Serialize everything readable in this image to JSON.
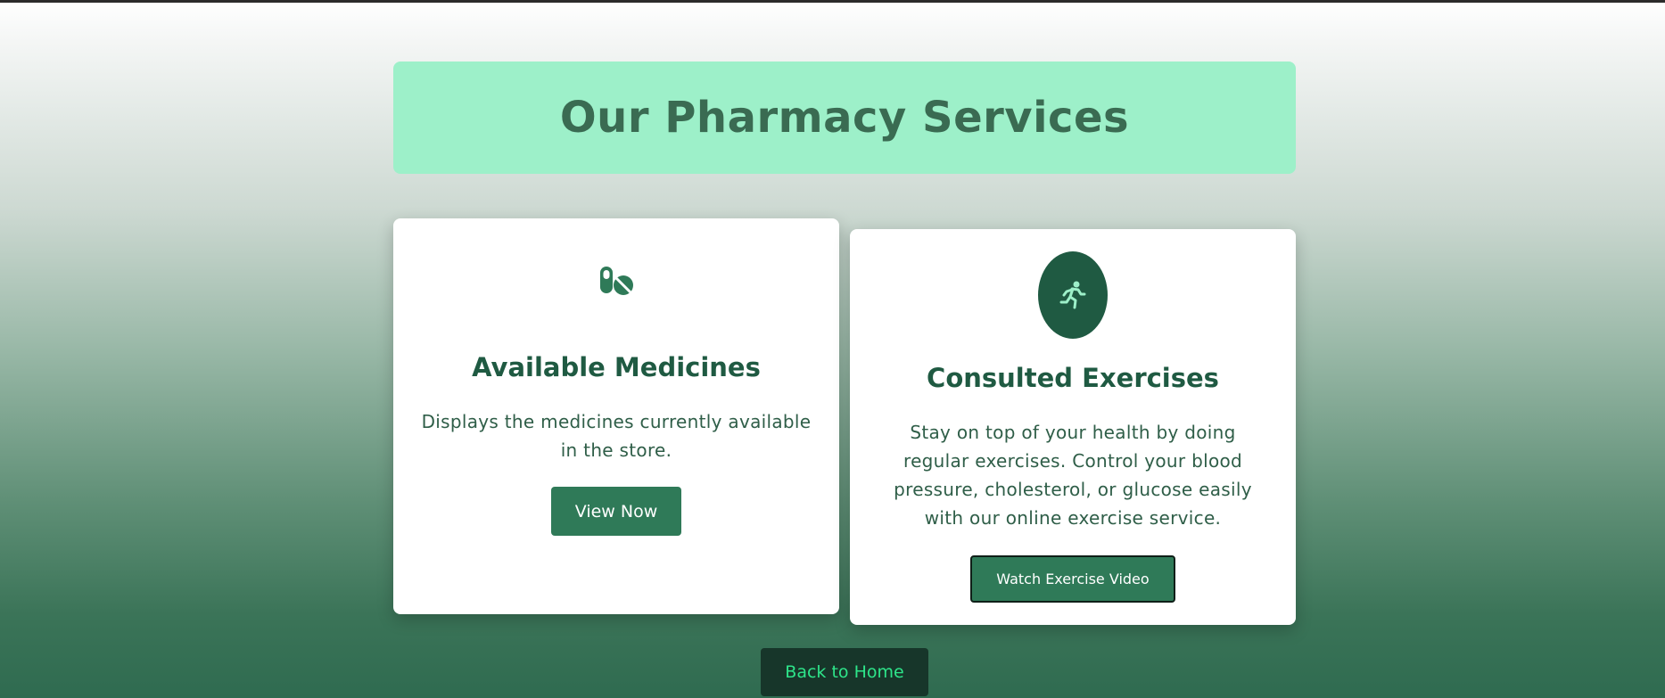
{
  "header": {
    "title": "Our Pharmacy Services"
  },
  "cards": [
    {
      "icon": "pills-icon",
      "title": "Available Medicines",
      "description": "Displays the medicines currently available in the store.",
      "button_label": "View Now"
    },
    {
      "icon": "running-person-icon",
      "title": "Consulted Exercises",
      "description": "Stay on top of your health by doing regular exercises. Control your blood pressure, cholesterol, or glucose easily with our online exercise service.",
      "button_label": "Watch Exercise Video"
    }
  ],
  "footer": {
    "back_label": "Back to Home"
  },
  "colors": {
    "banner": "#9df0c9",
    "primary_green": "#2f7a58",
    "dark_green": "#1f5a42",
    "home_button_bg": "#17362a",
    "home_button_text": "#2ee58a"
  }
}
